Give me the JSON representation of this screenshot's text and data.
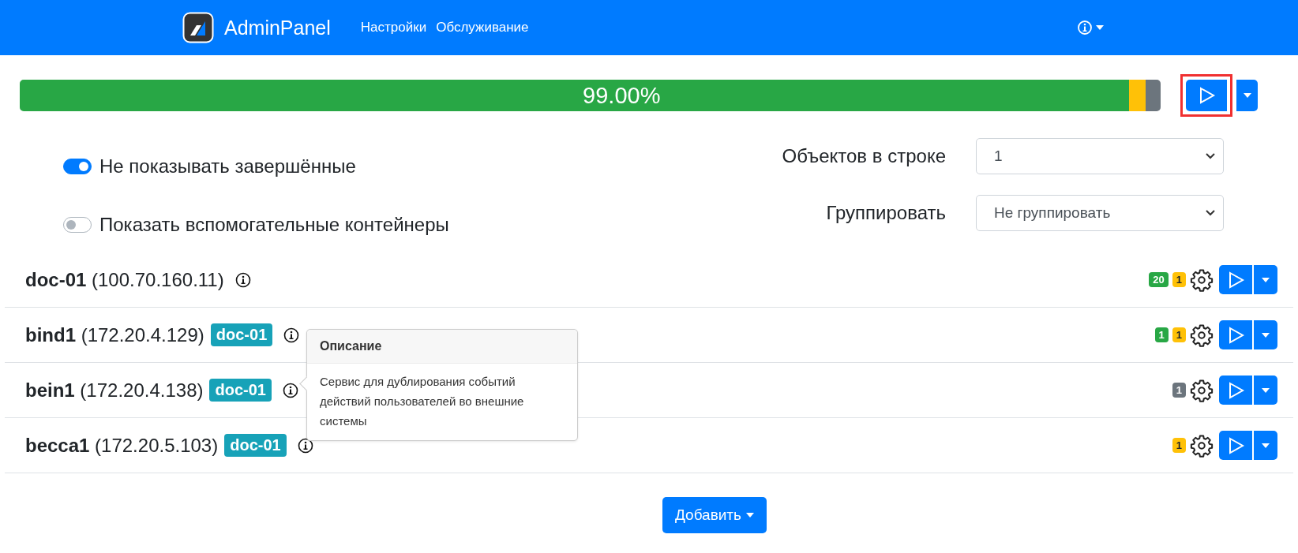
{
  "navbar": {
    "brand": "AdminPanel",
    "links": [
      "Настройки",
      "Обслуживание"
    ]
  },
  "progress": {
    "label": "99.00%",
    "level": 0.972
  },
  "run_button": {
    "highlighted": true
  },
  "toggles": [
    {
      "label": "Не показывать завершённые",
      "on": true
    },
    {
      "label": "Показать вспомогательные контейнеры",
      "on": false
    }
  ],
  "settings": [
    {
      "label": "Объектов в строке",
      "value": "1"
    },
    {
      "label": "Группировать",
      "value": "Не группировать"
    }
  ],
  "hosts": [
    {
      "name": "doc-01",
      "ip": "(100.70.160.11)",
      "badges": [
        {
          "text": "20",
          "color": "#28a745"
        },
        {
          "text": "1",
          "color": "#ffc107"
        }
      ]
    },
    {
      "name": "bind1",
      "ip": "(172.20.4.129)",
      "tag": "doc-01",
      "badges": [
        {
          "text": "1",
          "color": "#28a745"
        },
        {
          "text": "1",
          "color": "#ffc107"
        }
      ]
    },
    {
      "name": "bein1",
      "ip": "(172.20.4.138)",
      "tag": "doc-01",
      "badges": [
        {
          "text": "1",
          "color": "#6c757d"
        }
      ]
    },
    {
      "name": "becca1",
      "ip": "(172.20.5.103)",
      "tag": "doc-01",
      "badges": [
        {
          "text": "1",
          "color": "#ffc107"
        }
      ]
    }
  ],
  "tooltip": {
    "title": "Описание",
    "text": "Сервис для дублирования событий действий пользователей во внешние системы"
  },
  "add_button": "Добавить"
}
